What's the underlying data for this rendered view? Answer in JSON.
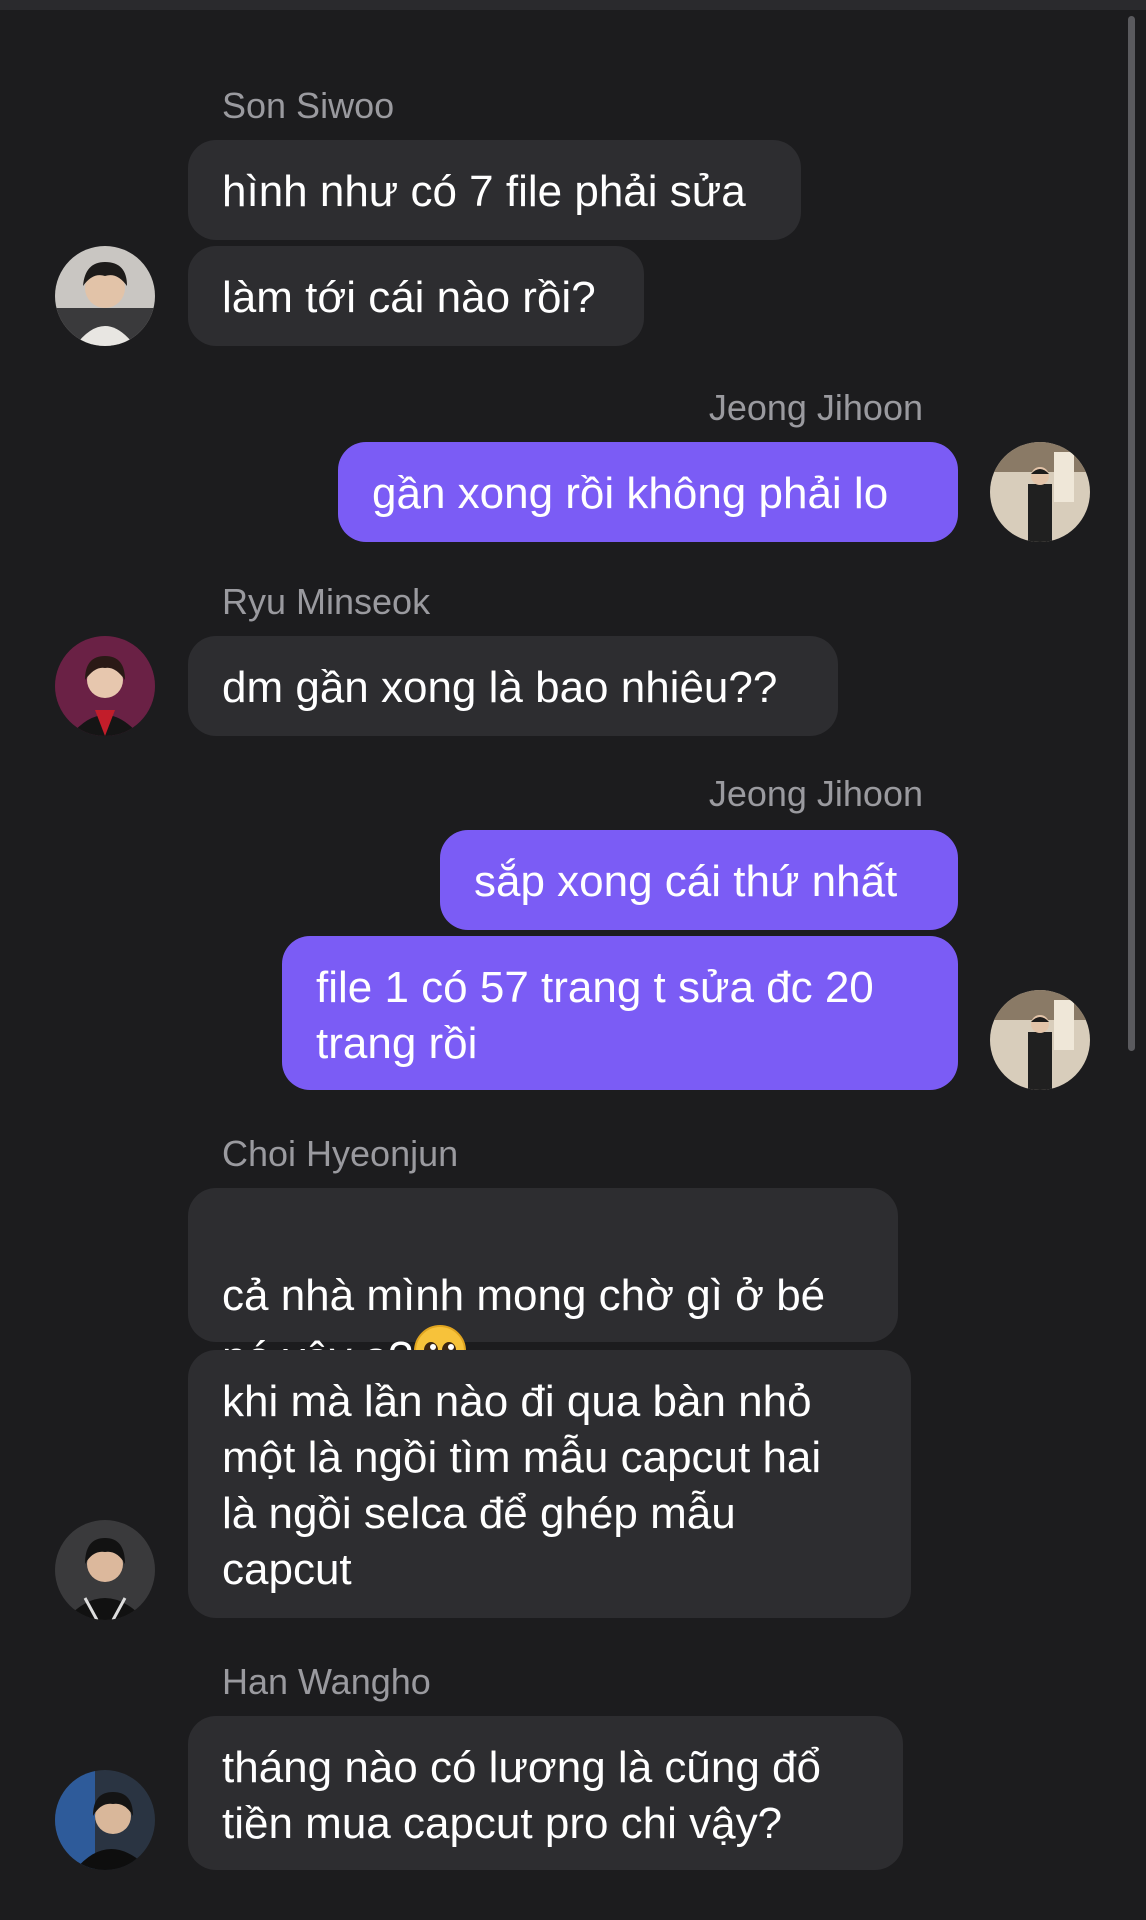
{
  "thread": {
    "messages": [
      {
        "sender": "Son Siwoo",
        "side": "in",
        "lines": [
          "hình như có 7 file phải sửa",
          "làm tới cái nào rồi?"
        ]
      },
      {
        "sender": "Jeong Jihoon",
        "side": "out",
        "lines": [
          "gần xong rồi không phải lo"
        ]
      },
      {
        "sender": "Ryu Minseok",
        "side": "in",
        "lines": [
          "dm gần xong là bao nhiêu??"
        ]
      },
      {
        "sender": "Jeong Jihoon",
        "side": "out",
        "lines": [
          "sắp xong cái thứ nhất",
          "file 1 có 57 trang t sửa đc 20\ntrang rồi"
        ]
      },
      {
        "sender": "Choi Hyeonjun",
        "side": "in",
        "lines": [
          "cả nhà mình mong chờ gì ở bé\nnó vậy ạ?",
          "khi mà lần nào đi qua bàn nhỏ\nmột là ngồi tìm mẫu capcut hai\nlà ngồi selca để ghép mẫu\ncapcut"
        ]
      },
      {
        "sender": "Han Wangho",
        "side": "in",
        "lines": [
          "tháng nào có lương là cũng đổ\ntiền mua capcut pro chi vậy?"
        ]
      }
    ],
    "emoji": "pleading-face-emoji"
  },
  "colors": {
    "background": "#1c1c1e",
    "incoming_bubble": "#2d2d30",
    "outgoing_bubble": "#7b5cf5",
    "sender_name": "#9a9a9f"
  }
}
